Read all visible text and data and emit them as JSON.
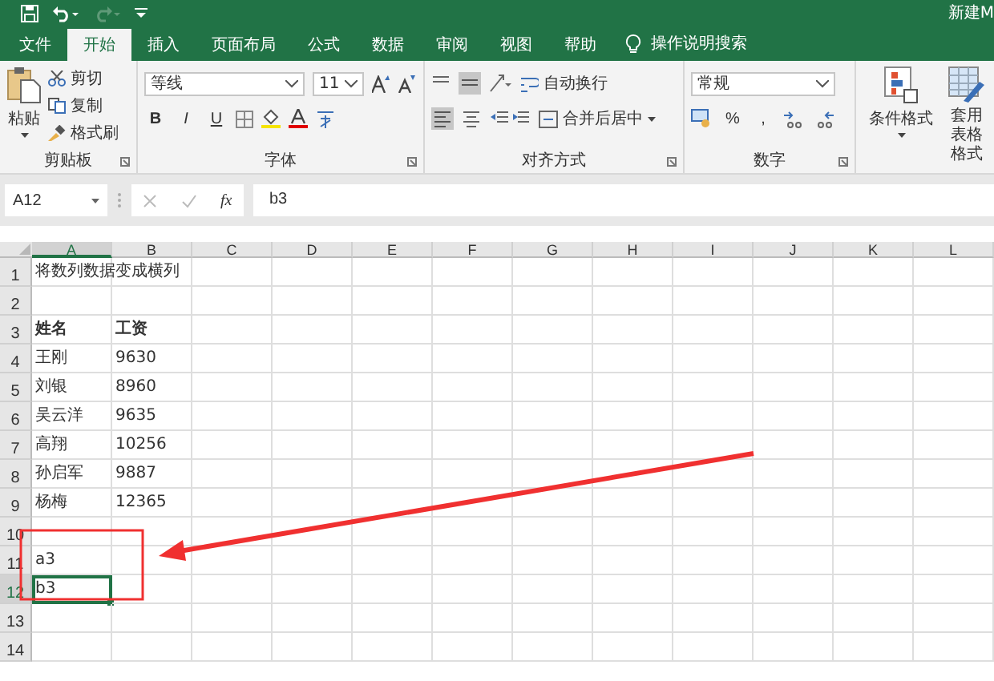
{
  "window": {
    "title": "新建M"
  },
  "tabs": [
    {
      "label": "文件",
      "selected": false
    },
    {
      "label": "开始",
      "selected": true
    },
    {
      "label": "插入",
      "selected": false
    },
    {
      "label": "页面布局",
      "selected": false
    },
    {
      "label": "公式",
      "selected": false
    },
    {
      "label": "数据",
      "selected": false
    },
    {
      "label": "审阅",
      "selected": false
    },
    {
      "label": "视图",
      "selected": false
    },
    {
      "label": "帮助",
      "selected": false
    }
  ],
  "tell_me": "操作说明搜索",
  "ribbon": {
    "clipboard": {
      "paste": "粘贴",
      "cut": "剪切",
      "copy": "复制",
      "format_painter": "格式刷",
      "label": "剪贴板"
    },
    "font": {
      "font_name": "等线",
      "font_size": "11",
      "bold": "B",
      "italic": "I",
      "underline": "U",
      "label": "字体"
    },
    "alignment": {
      "wrap_text": "自动换行",
      "merge_center": "合并后居中",
      "label": "对齐方式"
    },
    "number": {
      "format": "常规",
      "percent": "%",
      "comma": ",",
      "label": "数字"
    },
    "styles": {
      "conditional_format": "条件格式",
      "table_format": [
        "套用",
        "表格格式"
      ]
    }
  },
  "formula_bar": {
    "name_box": "A12",
    "fx": "fx",
    "value": "b3"
  },
  "columns": [
    {
      "label": "A",
      "selected": true
    },
    {
      "label": "B",
      "selected": false
    },
    {
      "label": "C",
      "selected": false
    },
    {
      "label": "D",
      "selected": false
    },
    {
      "label": "E",
      "selected": false
    },
    {
      "label": "F",
      "selected": false
    },
    {
      "label": "G",
      "selected": false
    },
    {
      "label": "H",
      "selected": false
    },
    {
      "label": "I",
      "selected": false
    },
    {
      "label": "J",
      "selected": false
    },
    {
      "label": "K",
      "selected": false
    },
    {
      "label": "L",
      "selected": false
    }
  ],
  "rows": [
    {
      "label": "1",
      "selected": false,
      "cells": [
        {
          "text": "将数列数据变成横列",
          "bold": false,
          "selected": false
        },
        {
          "selected": false
        }
      ]
    },
    {
      "label": "2",
      "selected": false,
      "cells": [
        {
          "selected": false
        },
        {
          "selected": false
        }
      ]
    },
    {
      "label": "3",
      "selected": false,
      "cells": [
        {
          "text": "姓名",
          "bold": true,
          "selected": false
        },
        {
          "text": "工资",
          "bold": true,
          "selected": false
        }
      ]
    },
    {
      "label": "4",
      "selected": false,
      "cells": [
        {
          "text": "王刚",
          "bold": false,
          "selected": false
        },
        {
          "text": "9630",
          "bold": false,
          "selected": false
        }
      ]
    },
    {
      "label": "5",
      "selected": false,
      "cells": [
        {
          "text": "刘银",
          "bold": false,
          "selected": false
        },
        {
          "text": "8960",
          "bold": false,
          "selected": false
        }
      ]
    },
    {
      "label": "6",
      "selected": false,
      "cells": [
        {
          "text": "吴云洋",
          "bold": false,
          "selected": false
        },
        {
          "text": "9635",
          "bold": false,
          "selected": false
        }
      ]
    },
    {
      "label": "7",
      "selected": false,
      "cells": [
        {
          "text": "高翔",
          "bold": false,
          "selected": false
        },
        {
          "text": "10256",
          "bold": false,
          "selected": false
        }
      ]
    },
    {
      "label": "8",
      "selected": false,
      "cells": [
        {
          "text": "孙启军",
          "bold": false,
          "selected": false
        },
        {
          "text": "9887",
          "bold": false,
          "selected": false
        }
      ]
    },
    {
      "label": "9",
      "selected": false,
      "cells": [
        {
          "text": "杨梅",
          "bold": false,
          "selected": false
        },
        {
          "text": "12365",
          "bold": false,
          "selected": false
        }
      ]
    },
    {
      "label": "10",
      "selected": false,
      "cells": [
        {
          "selected": false
        },
        {
          "selected": false
        }
      ]
    },
    {
      "label": "11",
      "selected": false,
      "cells": [
        {
          "text": "a3",
          "bold": false,
          "selected": false
        },
        {
          "selected": false
        }
      ]
    },
    {
      "label": "12",
      "selected": true,
      "cells": [
        {
          "text": "b3",
          "bold": false,
          "selected": true
        },
        {
          "selected": false
        }
      ]
    },
    {
      "label": "13",
      "selected": false,
      "cells": [
        {
          "selected": false
        },
        {
          "selected": false
        }
      ]
    },
    {
      "label": "14",
      "selected": false,
      "cells": [
        {
          "selected": false
        },
        {
          "selected": false
        }
      ]
    }
  ]
}
